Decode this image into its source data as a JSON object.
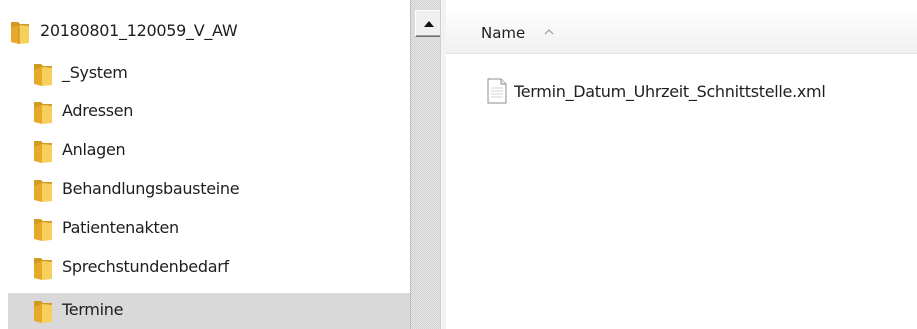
{
  "tree": {
    "root": {
      "label": "20180801_120059_V_AW",
      "icon": "folder-icon"
    },
    "items": [
      {
        "label": "_System",
        "icon": "folder-icon",
        "selected": false
      },
      {
        "label": "Adressen",
        "icon": "folder-icon",
        "selected": false
      },
      {
        "label": "Anlagen",
        "icon": "folder-icon",
        "selected": false
      },
      {
        "label": "Behandlungsbausteine",
        "icon": "folder-icon",
        "selected": false
      },
      {
        "label": "Patientenakten",
        "icon": "folder-icon",
        "selected": false
      },
      {
        "label": "Sprechstundenbedarf",
        "icon": "folder-icon",
        "selected": false
      },
      {
        "label": "Termine",
        "icon": "folder-icon",
        "selected": true
      }
    ]
  },
  "scrollbar": {
    "up_icon": "triangle-up-icon"
  },
  "filelist": {
    "column_name": "Name",
    "sort_icon": "sort-ascending-icon",
    "files": [
      {
        "label": "Termin_Datum_Uhrzeit_Schnittstelle.xml",
        "icon": "xml-file-icon"
      }
    ]
  },
  "colors": {
    "folder_front": "#f3c24a",
    "folder_back": "#d19a23",
    "selection": "#d9d9d9"
  }
}
